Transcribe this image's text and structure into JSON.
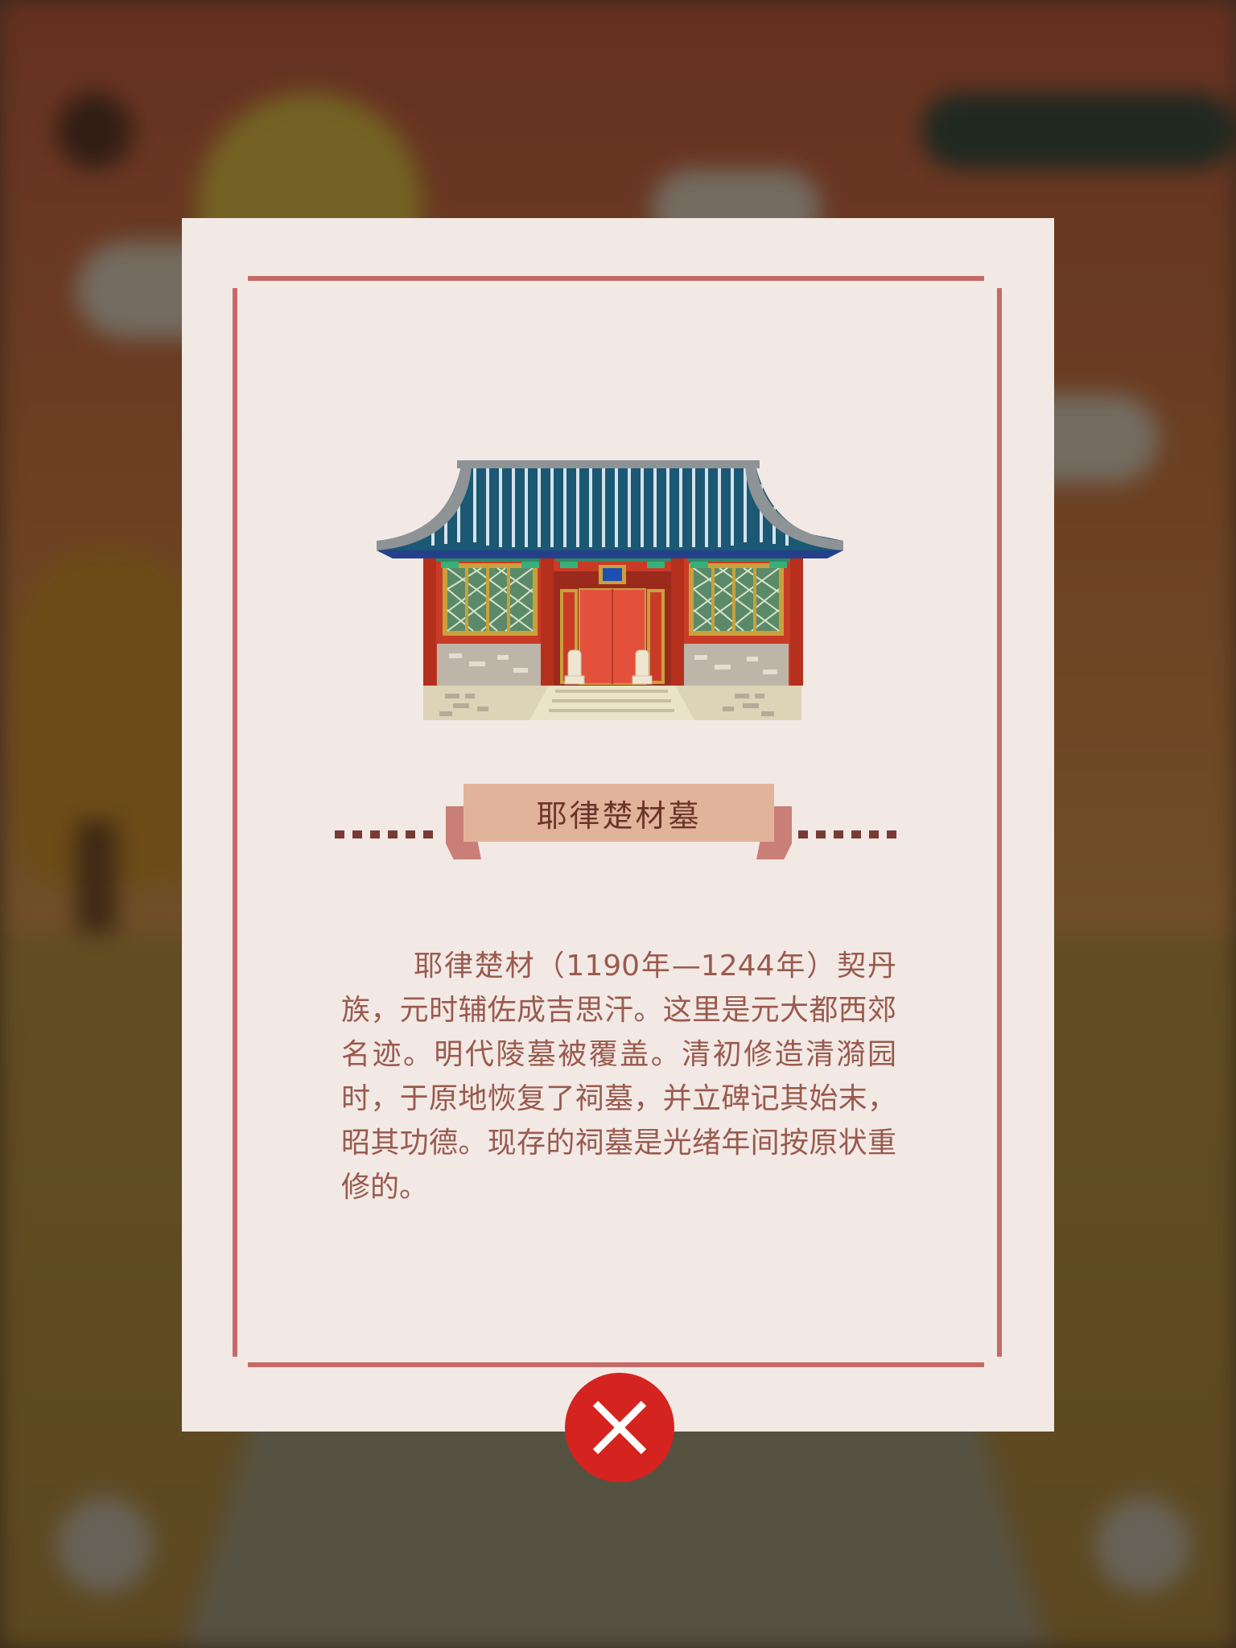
{
  "dialog": {
    "title": "耶律楚材墓",
    "description": "耶律楚材（1190年—1244年）契丹族，元时辅佐成吉思汗。这里是元大都西郊名迹。明代陵墓被覆盖。清初修造清漪园时，于原地恢复了祠墓，并立碑记其始末，昭其功德。现存的祠墓是光绪年间按原状重修的。",
    "illustration": "temple-hall-illustration",
    "close_icon": "close-icon"
  },
  "colors": {
    "card_bg": "#f2e9e5",
    "frame": "#c56a66",
    "ribbon": "#e2b39b",
    "title_text": "#6b3429",
    "body_text": "#9a5a4e",
    "close_button": "#d5231f"
  }
}
